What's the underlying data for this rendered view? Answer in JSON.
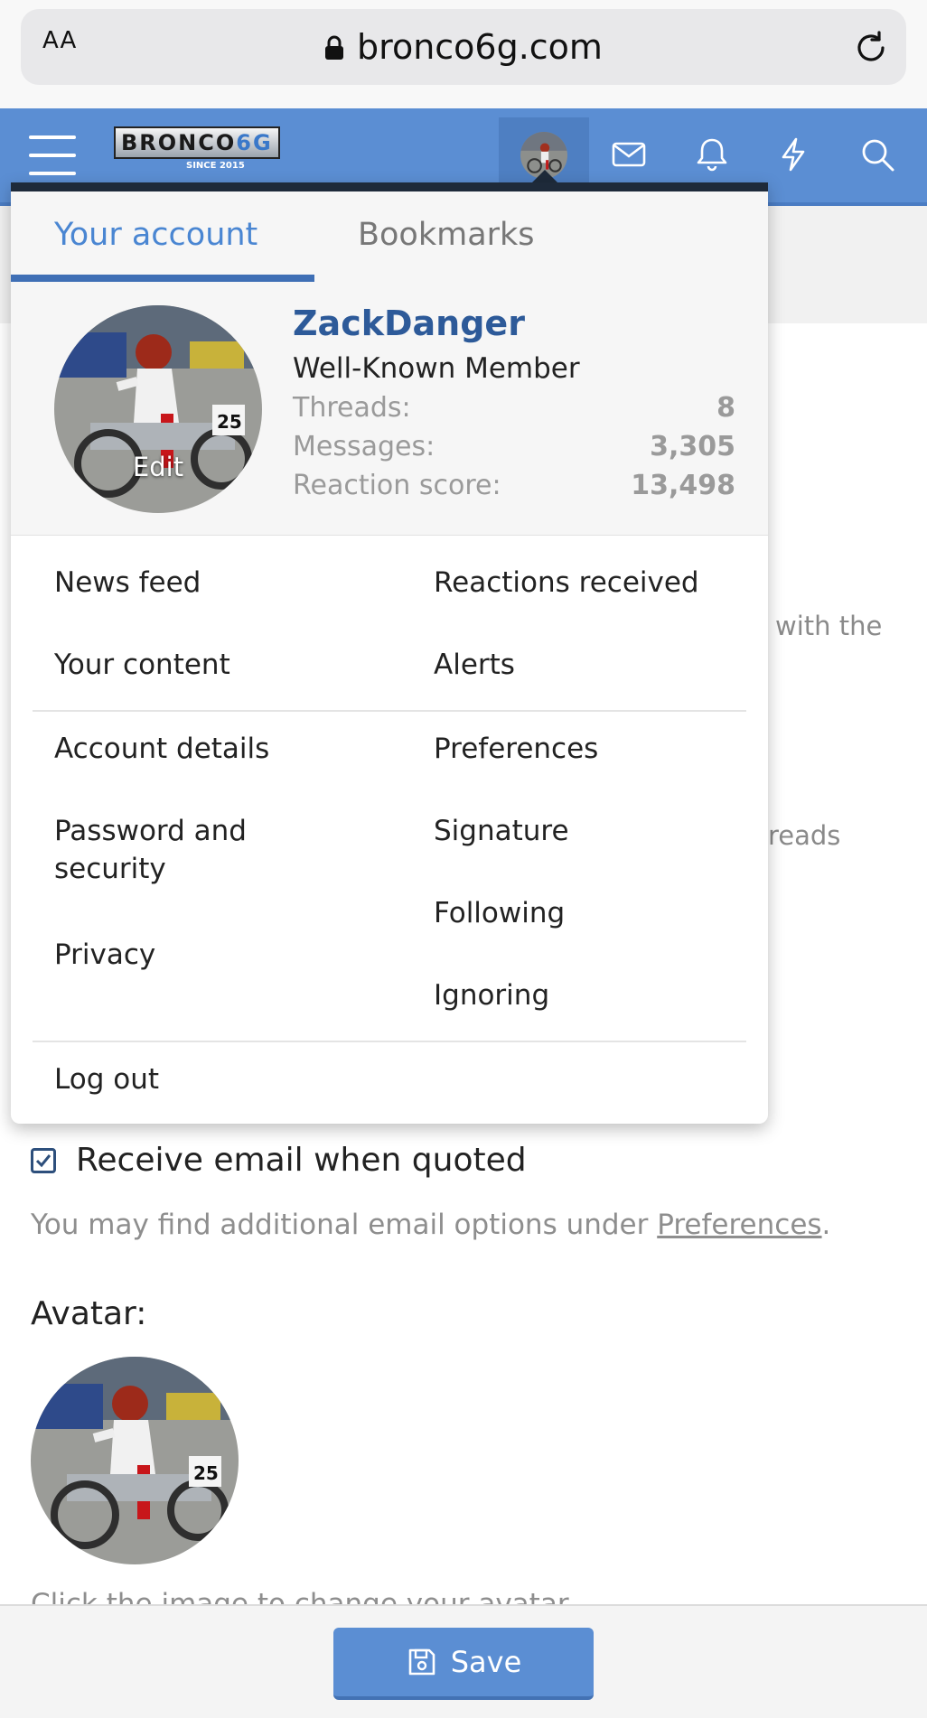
{
  "browser": {
    "text_size_button": "AA",
    "url": "bronco6g.com"
  },
  "header": {
    "logo_main": "BRONCO",
    "logo_accent": "6G",
    "logo_since": "SINCE 2015"
  },
  "menu": {
    "tabs": [
      {
        "label": "Your account",
        "active": true
      },
      {
        "label": "Bookmarks",
        "active": false
      }
    ],
    "profile": {
      "avatar_edit_label": "Edit",
      "username": "ZackDanger",
      "user_title": "Well-Known Member",
      "stats": [
        {
          "label": "Threads:",
          "value": "8"
        },
        {
          "label": "Messages:",
          "value": "3,305"
        },
        {
          "label": "Reaction score:",
          "value": "13,498"
        }
      ]
    },
    "links": {
      "news_feed": "News feed",
      "your_content": "Your content",
      "reactions_received": "Reactions received",
      "alerts": "Alerts",
      "account_details": "Account details",
      "password_line1": "Password and",
      "password_line2": "security",
      "privacy": "Privacy",
      "preferences": "Preferences",
      "signature": "Signature",
      "following": "Following",
      "ignoring": "Ignoring",
      "log_out": "Log out"
    }
  },
  "page": {
    "bg_fragment_1": "with the",
    "bg_fragment_2": "reads",
    "checkbox_label": "Receive email when quoted",
    "checkbox_checked": true,
    "hint_prefix": "You may find additional email options under ",
    "hint_link": "Preferences",
    "hint_suffix": ".",
    "avatar_section_label": "Avatar:",
    "avatar_hint": "Click the image to change your avatar."
  },
  "footer": {
    "save_label": "Save"
  },
  "colors": {
    "header_blue": "#5b8ed3",
    "accent_blue": "#4a86d2",
    "username_blue": "#2d5a99",
    "menu_top_border": "#1e2a3a"
  }
}
